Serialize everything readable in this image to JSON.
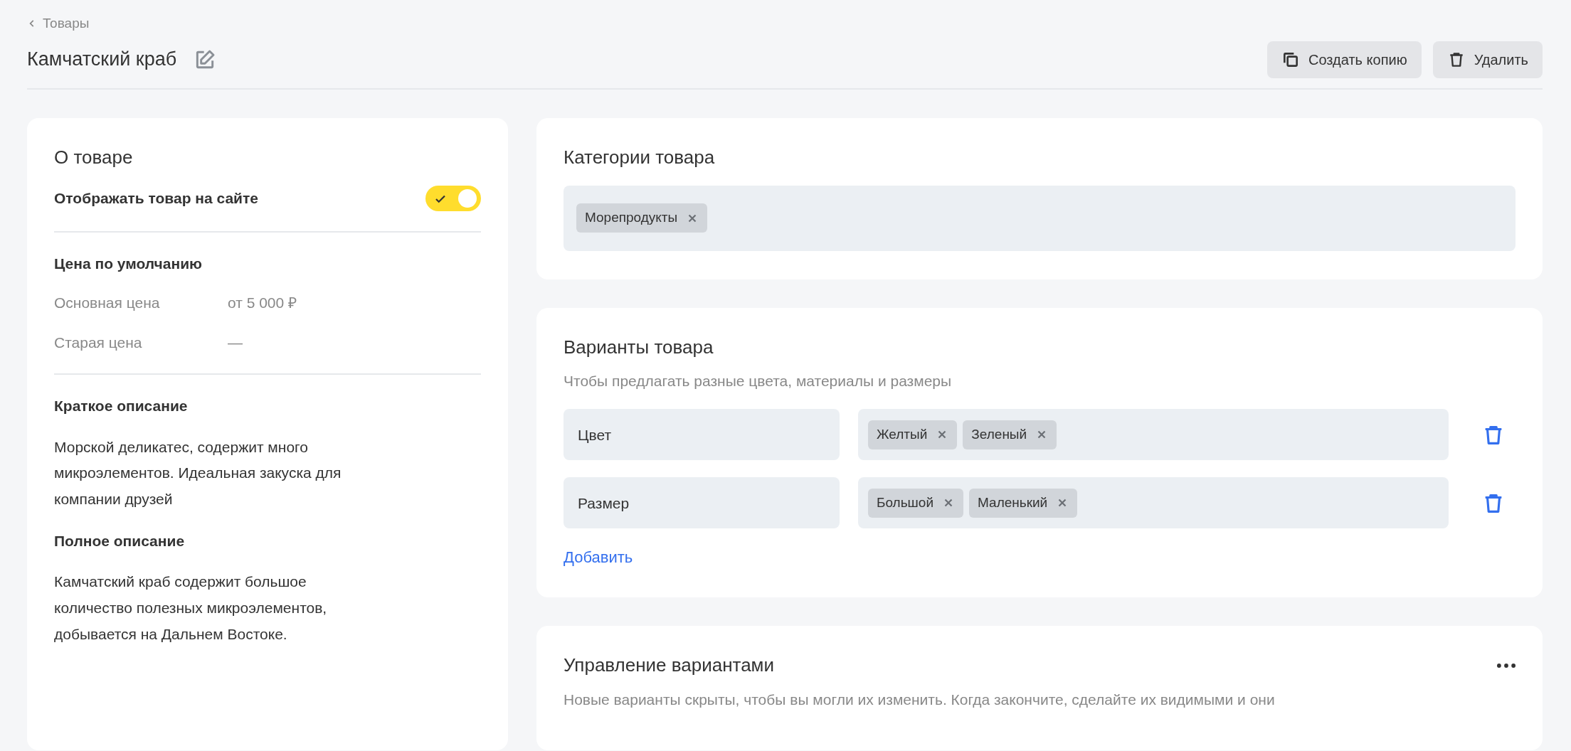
{
  "breadcrumb": {
    "label": "Товары"
  },
  "title": "Камчатский краб",
  "actions": [
    {
      "label": "Создать копию",
      "kind": "copy"
    },
    {
      "label": "Удалить",
      "kind": "delete"
    }
  ],
  "about": {
    "title": "О товаре",
    "visibility": {
      "label": "Отображать товар на сайте",
      "on": true
    },
    "price": {
      "title": "Цена по умолчанию",
      "rows": [
        {
          "label": "Основная цена",
          "value": "от 5 000 ₽"
        },
        {
          "label": "Старая цена",
          "value": "—"
        }
      ]
    },
    "short_description": {
      "title": "Краткое описание",
      "text": "Морской деликатес, содержит много микроэлементов. Идеальная закуска для компании друзей"
    },
    "full_description": {
      "title": "Полное описание",
      "text": "Камчатский краб содержит большое количество полезных микроэлементов, добывается на Дальнем Востоке."
    }
  },
  "categories": {
    "title": "Категории товара",
    "tags": [
      "Морепродукты"
    ]
  },
  "variants": {
    "title": "Варианты товара",
    "subtitle": "Чтобы предлагать разные цвета, материалы и размеры",
    "options": [
      {
        "name": "Цвет",
        "values": [
          "Желтый",
          "Зеленый"
        ]
      },
      {
        "name": "Размер",
        "values": [
          "Большой",
          "Маленький"
        ]
      }
    ],
    "add_link": "Добавить"
  },
  "variant_management": {
    "title": "Управление вариантами",
    "description": "Новые варианты скрыты, чтобы вы могли их изменить. Когда закончите, сделайте их видимыми и они"
  }
}
